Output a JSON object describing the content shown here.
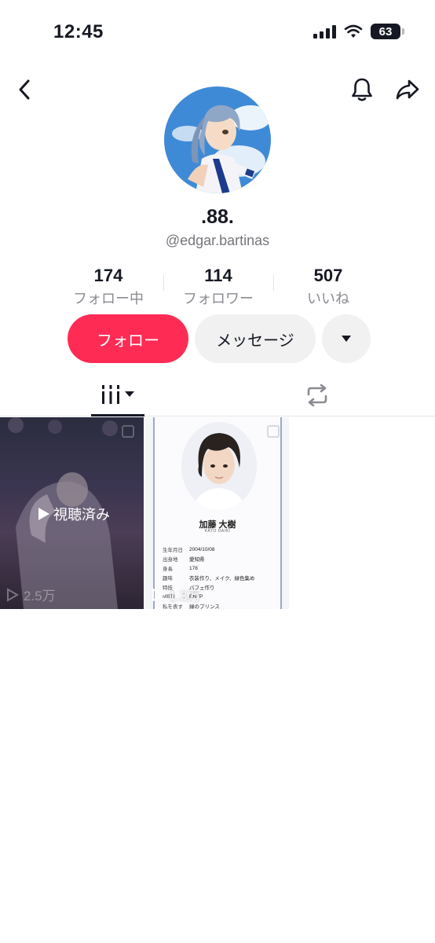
{
  "status_bar": {
    "time": "12:45",
    "battery": "63"
  },
  "profile": {
    "nickname": ".88.",
    "username": "@edgar.bartinas"
  },
  "stats": [
    {
      "value": "174",
      "label": "フォロー中"
    },
    {
      "value": "114",
      "label": "フォロワー"
    },
    {
      "value": "507",
      "label": "いいね"
    }
  ],
  "buttons": {
    "follow": "フォロー",
    "message": "メッセージ"
  },
  "videos": [
    {
      "overlay": "視聴済み",
      "views": "2.5万"
    },
    {
      "views": "1.3万",
      "card": {
        "name": "加藤 大樹",
        "roman": "KATO DAIKI",
        "rows": [
          {
            "k": "生年月日",
            "v": "2004/10/08"
          },
          {
            "k": "出身地",
            "v": "愛知県"
          },
          {
            "k": "身長",
            "v": "178"
          },
          {
            "k": "趣味",
            "v": "衣装作り、メイク、緑色集め"
          },
          {
            "k": "特技",
            "v": "パフェ作り"
          },
          {
            "k": "MBTI",
            "v": "ENTP"
          },
          {
            "k": "私を表す",
            "v": "緑のプリンス"
          }
        ]
      }
    }
  ],
  "colors": {
    "accent": "#fe2c55",
    "text": "#161823",
    "muted": "#8a8b91"
  },
  "icons": [
    "back-icon",
    "bell-icon",
    "share-icon",
    "chevron-down-icon",
    "grid-icon",
    "repost-icon",
    "play-icon",
    "pin-icon"
  ]
}
